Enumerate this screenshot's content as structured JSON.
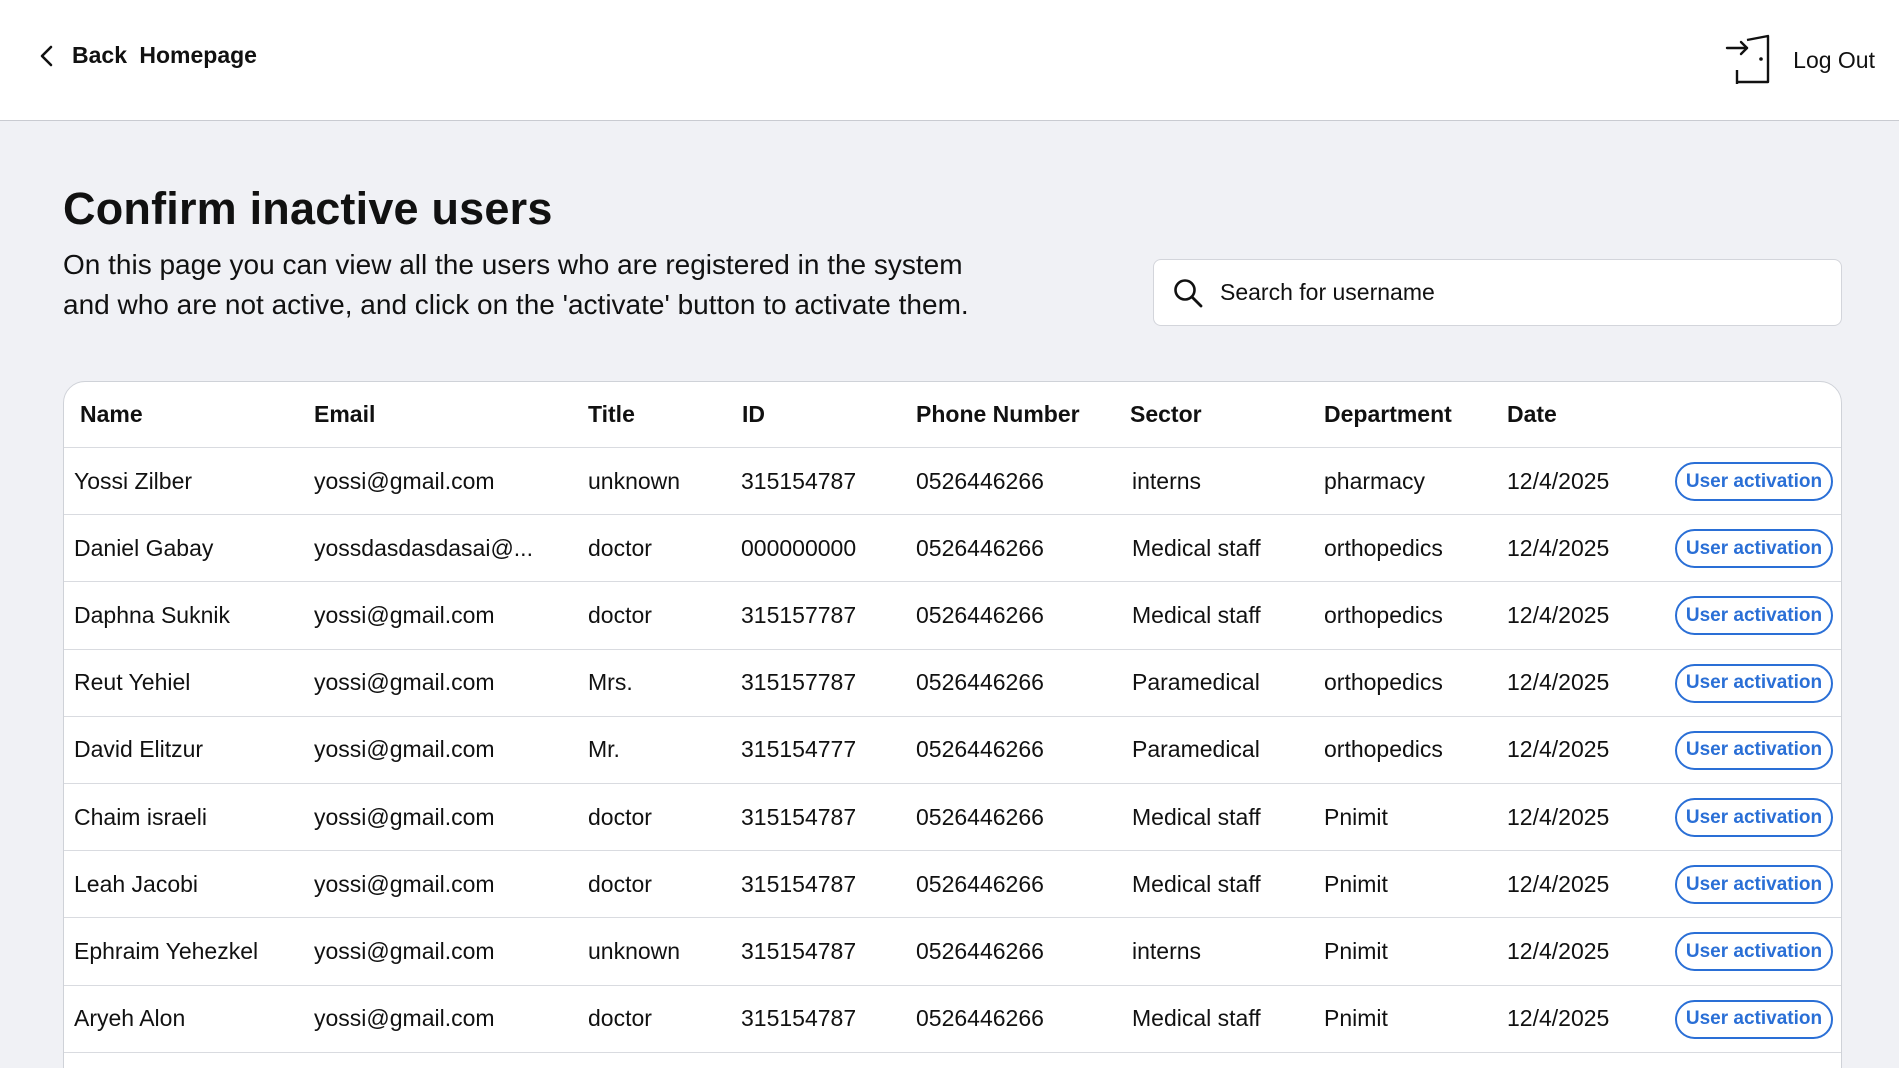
{
  "header": {
    "back_label": "Back  Homepage",
    "logout_label": "Log Out"
  },
  "page": {
    "title": "Confirm inactive users",
    "description_line1": "On this page you can view all the users who are registered in the system",
    "description_line2": "and who are not active, and click on the 'activate' button to activate them."
  },
  "search": {
    "placeholder": "Search for username",
    "value": ""
  },
  "table": {
    "columns": [
      "Name",
      "Email",
      "Title",
      "ID",
      "Phone Number",
      "Sector",
      "Department",
      "Date"
    ],
    "action_label": "User activation",
    "rows": [
      [
        "Yossi Zilber",
        "yossi@gmail.com",
        "unknown",
        "315154787",
        "0526446266",
        "interns",
        "pharmacy",
        "12/4/2025"
      ],
      [
        "Daniel Gabay",
        "yossdasdasdasai@...",
        "doctor",
        "000000000",
        "0526446266",
        "Medical staff",
        "orthopedics",
        "12/4/2025"
      ],
      [
        "Daphna Suknik",
        "yossi@gmail.com",
        "doctor",
        "315157787",
        "0526446266",
        "Medical staff",
        "orthopedics",
        "12/4/2025"
      ],
      [
        "Reut Yehiel",
        "yossi@gmail.com",
        "Mrs.",
        "315157787",
        "0526446266",
        "Paramedical",
        "orthopedics",
        "12/4/2025"
      ],
      [
        "David Elitzur",
        "yossi@gmail.com",
        "Mr.",
        "315154777",
        "0526446266",
        "Paramedical",
        "orthopedics",
        "12/4/2025"
      ],
      [
        "Chaim israeli",
        "yossi@gmail.com",
        "doctor",
        "315154787",
        "0526446266",
        "Medical staff",
        "Pnimit",
        "12/4/2025"
      ],
      [
        "Leah Jacobi",
        "yossi@gmail.com",
        "doctor",
        "315154787",
        "0526446266",
        "Medical staff",
        "Pnimit",
        "12/4/2025"
      ],
      [
        "Ephraim Yehezkel",
        "yossi@gmail.com",
        "unknown",
        "315154787",
        "0526446266",
        "interns",
        "Pnimit",
        "12/4/2025"
      ],
      [
        "Aryeh Alon",
        "yossi@gmail.com",
        "doctor",
        "315154787",
        "0526446266",
        "Medical staff",
        "Pnimit",
        "12/4/2025"
      ]
    ]
  },
  "colors": {
    "accent": "#2a6fd6",
    "background": "#f0f1f5"
  },
  "icons": {
    "back": "chevron-left-icon",
    "logout": "door-exit-icon",
    "search": "search-icon"
  }
}
